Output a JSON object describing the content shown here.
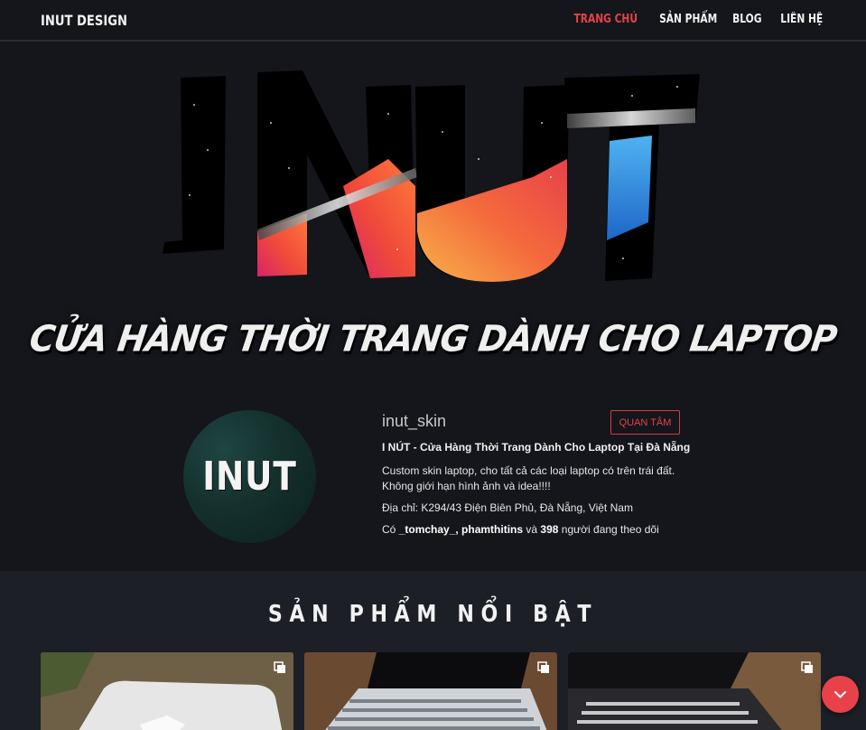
{
  "nav": {
    "brand": "INUT DESIGN",
    "links": [
      "TRANG CHỦ",
      "SẢN PHẨM",
      "BLOG",
      "LIÊN HỆ"
    ],
    "active_index": 0
  },
  "hero": {
    "logo_text": "INUT",
    "slogan": "CỬA HÀNG THỜI TRANG DÀNH CHO LAPTOP"
  },
  "profile": {
    "avatar_text": "INUT",
    "username": "inut_skin",
    "follow_label": "QUAN TÂM",
    "title": "I NÚT - Cửa Hàng Thời Trang Dành Cho Laptop Tại Đà Nẵng",
    "desc_line1": "Custom skin laptop, cho tất cả các loại laptop có trên trái đất.",
    "desc_line2": "Không giới hạn hình ảnh và idea!!!!",
    "address": "Địa chỉ: K294/43 Điện Biên Phủ, Đà Nẵng, Việt Nam",
    "followers_prefix": "Có ",
    "followers_names": "_tomchay_, phamthitins",
    "followers_mid": " và ",
    "followers_count": "398",
    "followers_suffix": " người đang theo dõi"
  },
  "featured": {
    "title": "SẢN PHẨM NỔI BẬT"
  },
  "colors": {
    "accent": "#e8414a",
    "background": "#14161b",
    "section_bg": "#1c1f26"
  },
  "icons": {
    "multi_image": "multiple-images-icon",
    "scroll_down": "chevron-down-icon"
  }
}
